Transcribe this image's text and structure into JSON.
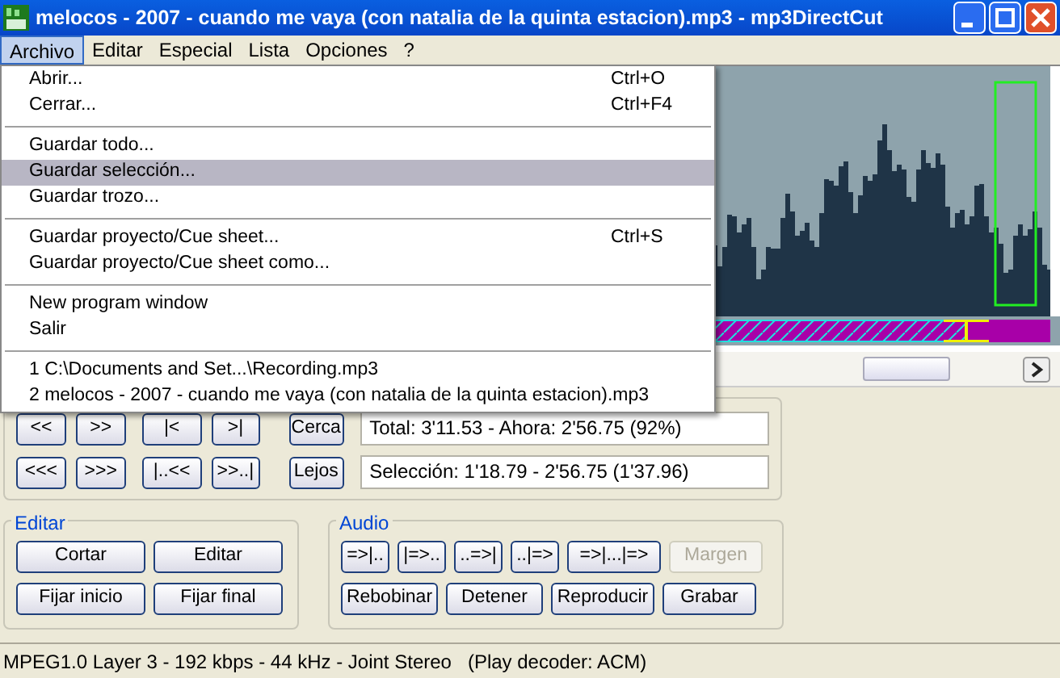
{
  "window": {
    "title": "melocos - 2007 - cuando me vaya (con natalia de la quinta estacion).mp3 - mp3DirectCut"
  },
  "menu_bar": [
    {
      "label": "Archivo",
      "selected": true
    },
    {
      "label": "Editar",
      "selected": false
    },
    {
      "label": "Especial",
      "selected": false
    },
    {
      "label": "Lista",
      "selected": false
    },
    {
      "label": "Opciones",
      "selected": false
    },
    {
      "label": "?",
      "selected": false
    }
  ],
  "open_menu": {
    "groups": [
      [
        {
          "label": "Abrir...",
          "shortcut": "Ctrl+O",
          "selected": false
        },
        {
          "label": "Cerrar...",
          "shortcut": "Ctrl+F4",
          "selected": false
        }
      ],
      [
        {
          "label": "Guardar todo...",
          "selected": false
        },
        {
          "label": "Guardar selección...",
          "selected": true
        },
        {
          "label": "Guardar trozo...",
          "selected": false
        }
      ],
      [
        {
          "label": "Guardar proyecto/Cue sheet...",
          "shortcut": "Ctrl+S",
          "selected": false
        },
        {
          "label": "Guardar proyecto/Cue sheet como...",
          "selected": false
        }
      ],
      [
        {
          "label": "New program window",
          "selected": false
        },
        {
          "label": "Salir",
          "selected": false
        }
      ],
      [
        {
          "label": "1 C:\\Documents and Set...\\Recording.mp3",
          "selected": false
        },
        {
          "label": "2 melocos - 2007 - cuando me vaya (con natalia de la quinta estacion).mp3",
          "selected": false
        }
      ]
    ]
  },
  "navigation": {
    "rows": [
      {
        "buttons": [
          "<<",
          ">>",
          "|<",
          ">|"
        ],
        "zoom_button": "Cerca",
        "info": "Total: 3'11.53 - Ahora: 2'56.75 (92%)"
      },
      {
        "buttons": [
          "<<<",
          ">>>",
          "|..<<",
          ">>..|"
        ],
        "zoom_button": "Lejos",
        "info": "Selección: 1'18.79 - 2'56.75 (1'37.96)"
      }
    ]
  },
  "edit_group": {
    "title": "Editar",
    "buttons": [
      {
        "label": "Cortar",
        "disabled": false
      },
      {
        "label": "Editar",
        "disabled": false
      },
      {
        "label": "Fijar inicio",
        "disabled": false
      },
      {
        "label": "Fijar final",
        "disabled": false
      }
    ]
  },
  "audio_group": {
    "title": "Audio",
    "buttons": [
      {
        "label": "=>|..",
        "disabled": false
      },
      {
        "label": "|=>..",
        "disabled": false
      },
      {
        "label": "..=>|",
        "disabled": false
      },
      {
        "label": "..|=>",
        "disabled": false
      },
      {
        "label": "=>|...|=>",
        "disabled": false
      },
      {
        "label": "Margen",
        "disabled": true
      },
      {
        "label": "Rebobinar",
        "disabled": false
      },
      {
        "label": "Detener",
        "disabled": false
      },
      {
        "label": "Reproducir",
        "disabled": false
      },
      {
        "label": "Grabar",
        "disabled": false
      }
    ]
  },
  "status_bar": {
    "text": "MPEG1.0 Layer 3 - 192 kbps - 44 kHz - Joint Stereo   (Play decoder: ACM)"
  }
}
